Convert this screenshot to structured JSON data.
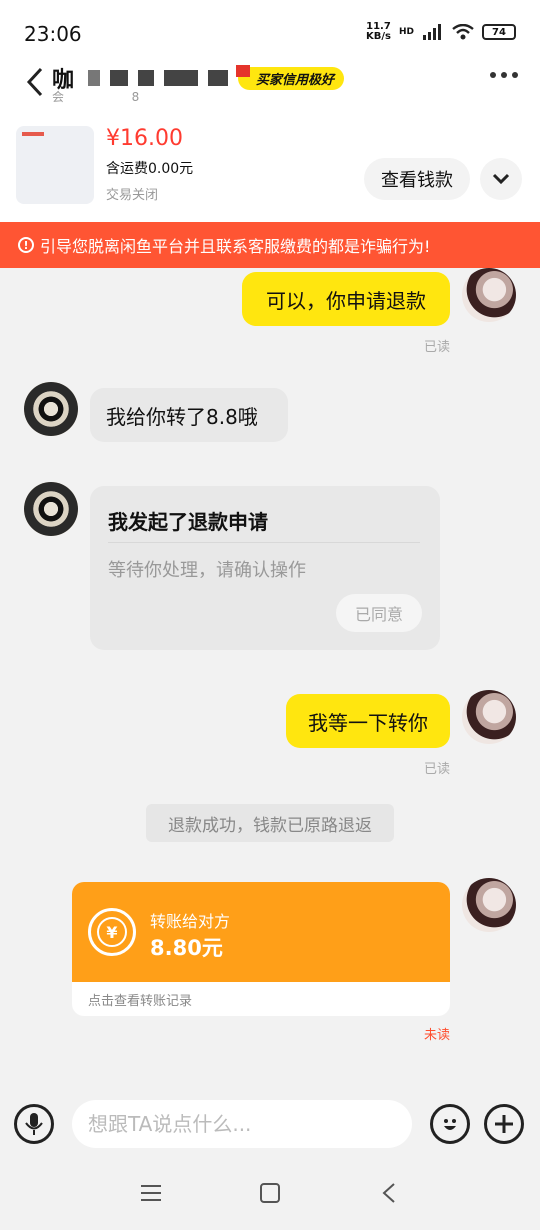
{
  "status_bar": {
    "time": "23:06",
    "net_speed": "11.7",
    "net_unit": "KB/s",
    "hd": "HD",
    "battery": "74"
  },
  "header": {
    "title": "咖",
    "subtitle": "会",
    "subtitle_tail": "8",
    "credit_badge": "买家信用极好"
  },
  "product": {
    "price": "¥16.00",
    "shipping": "含运费0.00元",
    "status": "交易关闭",
    "view_button": "查看钱款"
  },
  "warning": {
    "text": "引导您脱离闲鱼平台并且联系客服缴费的都是诈骗行为!",
    "icon": "!"
  },
  "messages": {
    "m1": {
      "text": "可以，你申请退款",
      "read": "已读"
    },
    "m2": {
      "text": "我给你转了8.8哦"
    },
    "refund_card": {
      "title": "我发起了退款申请",
      "desc": "等待你处理，请确认操作",
      "button": "已同意"
    },
    "m3": {
      "text": "我等一下转你",
      "read": "已读"
    },
    "system": "退款成功，钱款已原路退返",
    "transfer": {
      "label": "转账给对方",
      "amount": "8.80元",
      "footer": "点击查看转账记录",
      "icon": "¥",
      "read": "未读"
    }
  },
  "input": {
    "placeholder": "想跟TA说点什么..."
  },
  "icons": [
    "back-arrow-icon",
    "more-icon",
    "chevron-down-icon",
    "warning-icon",
    "microphone-icon",
    "emoji-icon",
    "plus-icon",
    "menu-icon",
    "home-square-icon",
    "nav-back-icon"
  ],
  "colors": {
    "accent": "#ffe60f",
    "warning": "#ff5533",
    "transfer": "#ff9f18",
    "price": "#ff3b30"
  }
}
